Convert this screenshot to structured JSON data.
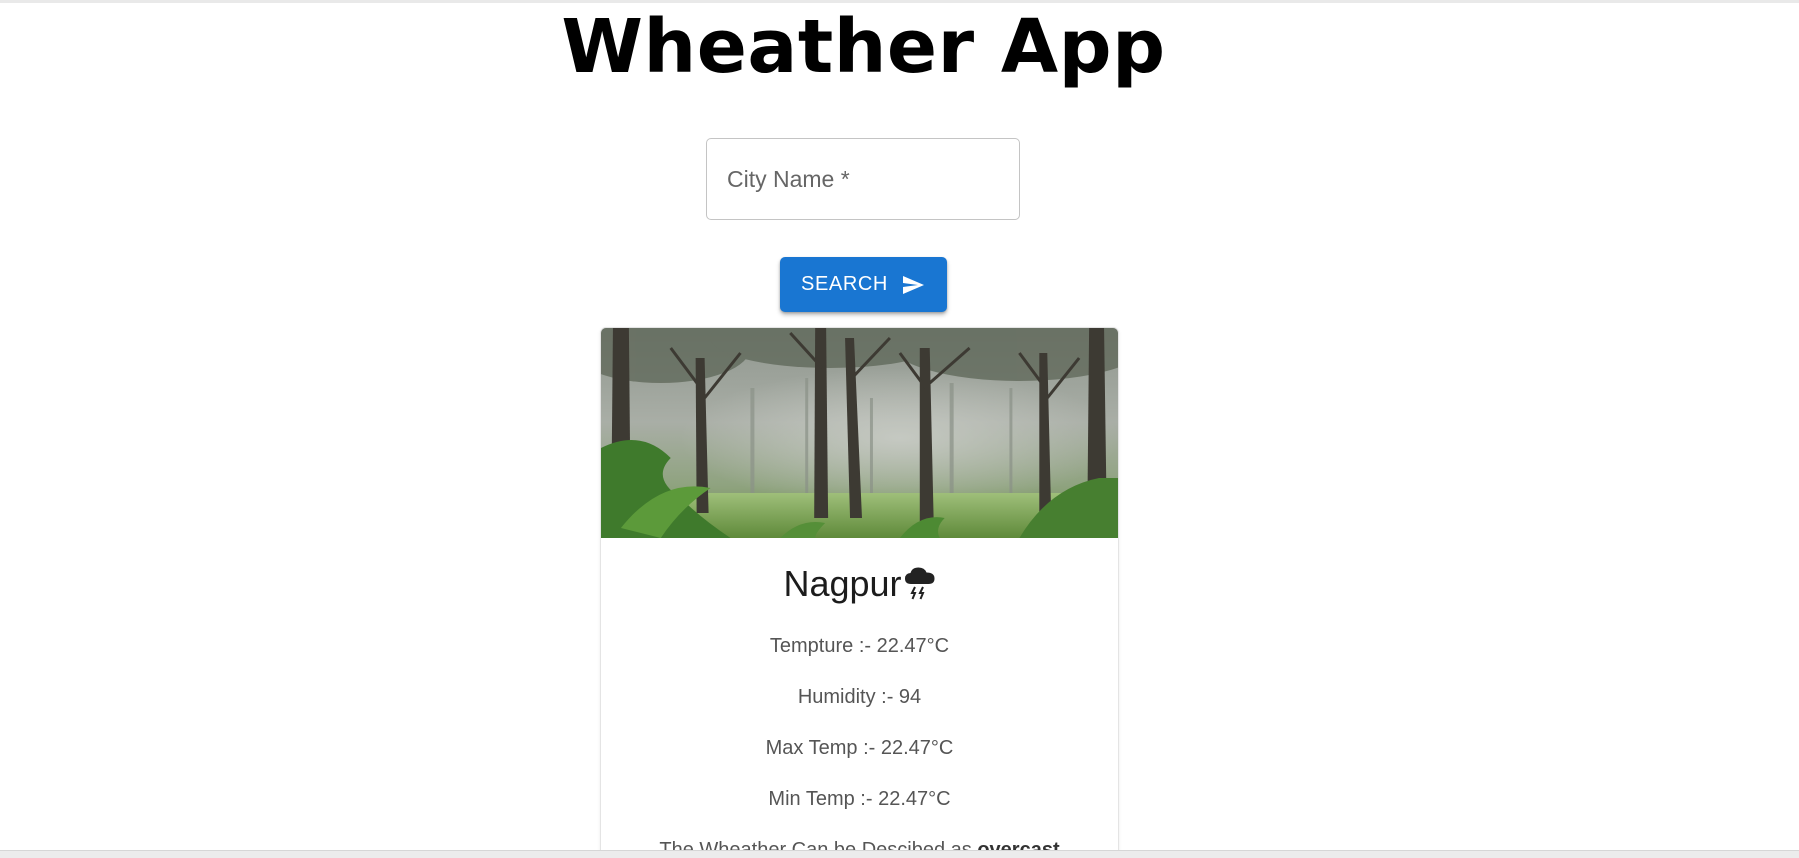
{
  "app": {
    "title": "Wheather App"
  },
  "search": {
    "placeholder": "City Name *",
    "value": "",
    "button_label": "SEARCH"
  },
  "card": {
    "city": "Nagpur",
    "weather_icon": "thunderstorm-cloud-icon",
    "temperature": "Tempture :- 22.47°C",
    "humidity": "Humidity :- 94",
    "max_temp": "Max Temp :- 22.47°C",
    "min_temp": "Min Temp :- 22.47°C",
    "description_prefix": "The Wheather Can be Descibed as ",
    "description_value": "overcast"
  },
  "colors": {
    "button": "#1976d2",
    "text_secondary": "#555555"
  }
}
